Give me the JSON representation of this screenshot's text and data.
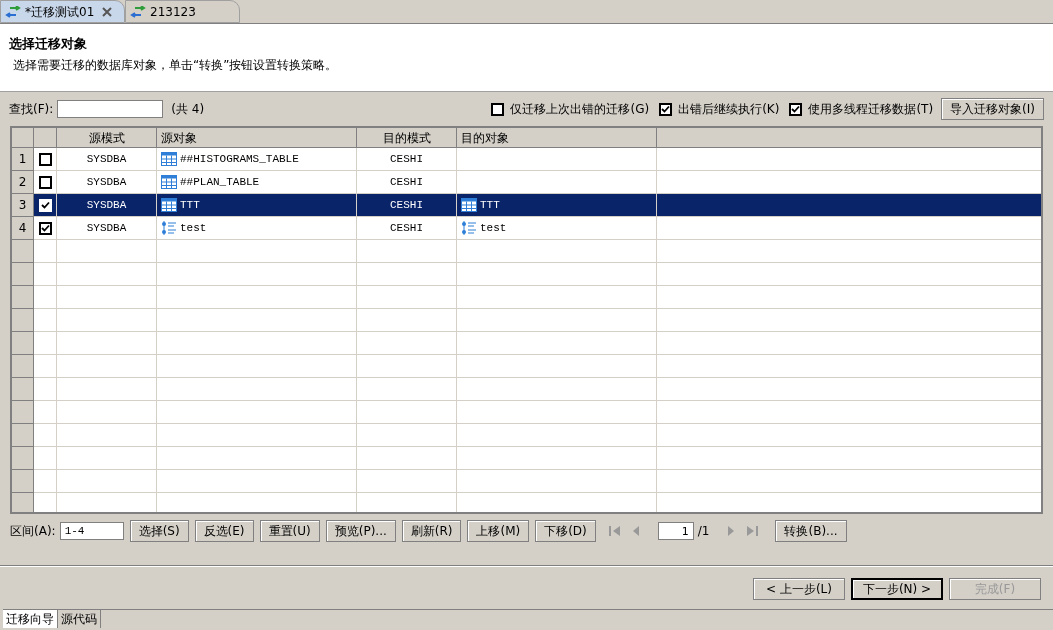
{
  "editor_tabs": [
    {
      "label": "*迁移测试01",
      "selected": true,
      "closable": true
    },
    {
      "label": "213123",
      "selected": false,
      "closable": false
    }
  ],
  "header": {
    "title": "选择迁移对象",
    "description": "选择需要迁移的数据库对象，单击“转换”按钮设置转换策略。"
  },
  "search": {
    "label": "查找(F):",
    "count": "(共 4)"
  },
  "options": [
    {
      "label": "仅迁移上次出错的迁移(G)",
      "checked": false
    },
    {
      "label": "出错后继续执行(K)",
      "checked": true
    },
    {
      "label": "使用多线程迁移数据(T)",
      "checked": true
    }
  ],
  "import_button": "导入迁移对象(I)",
  "table": {
    "columns": [
      "源模式",
      "源对象",
      "目的模式",
      "目的对象"
    ],
    "rows": [
      {
        "number": "1",
        "checked": false,
        "selected": false,
        "source_schema": "SYSDBA",
        "source_object": {
          "kind": "table",
          "name": "##HISTOGRAMS_TABLE"
        },
        "target_schema": "CESHI"
      },
      {
        "number": "2",
        "checked": false,
        "selected": false,
        "source_schema": "SYSDBA",
        "source_object": {
          "kind": "table",
          "name": "##PLAN_TABLE"
        },
        "target_schema": "CESHI"
      },
      {
        "number": "3",
        "checked": true,
        "selected": true,
        "source_schema": "SYSDBA",
        "source_object": {
          "kind": "table",
          "name": "TTT"
        },
        "target_schema": "CESHI",
        "target_object": {
          "kind": "table",
          "name": "TTT"
        }
      },
      {
        "number": "4",
        "checked": true,
        "selected": false,
        "source_schema": "SYSDBA",
        "source_object": {
          "kind": "sequence",
          "name": "test"
        },
        "target_schema": "CESHI",
        "target_object": {
          "kind": "sequence",
          "name": "test"
        }
      }
    ]
  },
  "range": {
    "label": "区间(A):",
    "value": "1-4"
  },
  "actions": [
    "选择(S)",
    "反选(E)",
    "重置(U)",
    "预览(P)...",
    "刷新(R)",
    "上移(M)",
    "下移(D)"
  ],
  "pager": {
    "page": "1",
    "total": "/1"
  },
  "convert_button": "转换(B)...",
  "wizard_buttons": [
    {
      "label": "< 上一步(L)",
      "disabled": false,
      "default": false
    },
    {
      "label": "下一步(N) >",
      "disabled": false,
      "default": true
    },
    {
      "label": "完成(F)",
      "disabled": true,
      "default": false
    }
  ],
  "bottom_tabs": [
    {
      "label": "迁移向导",
      "selected": true
    },
    {
      "label": "源代码",
      "selected": false
    }
  ]
}
